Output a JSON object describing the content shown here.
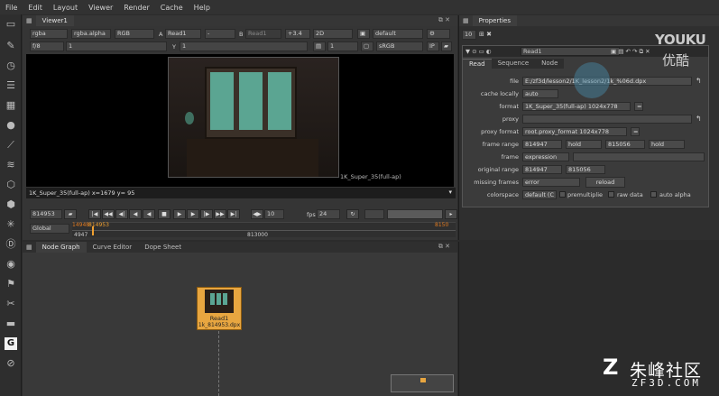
{
  "menu": [
    "File",
    "Edit",
    "Layout",
    "Viewer",
    "Render",
    "Cache",
    "Help"
  ],
  "viewer": {
    "tab": "Viewer1",
    "channels": "rgba",
    "alpha": "rgba.alpha",
    "color": "RGB",
    "a_label": "A",
    "a_input": "Read1",
    "b_label": "B",
    "b_input": "Read1",
    "gain": "+3.4",
    "mode": "2D",
    "lut": "default",
    "fstop": "f/8",
    "frame_in": "1",
    "y_label": "Y",
    "y_value": "1",
    "proxy_val": "1",
    "colorspace": "sRGB",
    "ip": "IP",
    "format_label": "1K_Super_35(full-ap)",
    "status": "1K_Super_35(full-ap)  x=1679 y= 95",
    "tc_current": "814953",
    "tc_step": "10",
    "fps_label": "fps",
    "fps": "24",
    "range_mode": "Global",
    "tick_start": "4947",
    "tick_mid": "813000",
    "tick_cur": "814953",
    "tick_left": "14948",
    "tick_end": "8150"
  },
  "nodegraph": {
    "tabs": [
      "Node Graph",
      "Curve Editor",
      "Dope Sheet"
    ],
    "node_name": "Read1",
    "node_file": "1k_814953.dpx"
  },
  "properties": {
    "tab": "Properties",
    "count": "10",
    "node_name": "Read1",
    "tabs": [
      "Read",
      "Sequence",
      "Node"
    ],
    "file_label": "file",
    "file": "E:/zf3d/lesson2/1K_lesson2/1k_%06d.dpx",
    "cache_label": "cache locally",
    "cache": "auto",
    "format_label": "format",
    "format": "1K_Super_35(full-ap) 1024x778",
    "proxy_label": "proxy",
    "proxy": "",
    "proxy_format_label": "proxy format",
    "proxy_format": "root.proxy_format 1024x778",
    "frame_range_label": "frame range",
    "frame_first": "814947",
    "first_mode": "hold",
    "frame_last": "815056",
    "last_mode": "hold",
    "frame_label": "frame",
    "frame_mode": "expression",
    "orig_range_label": "original range",
    "orig_first": "814947",
    "orig_last": "815056",
    "missing_label": "missing frames",
    "missing": "error",
    "reload": "reload",
    "colorspace_label": "colorspace",
    "colorspace": "default (C",
    "premultiplied": "premultiplie",
    "raw": "raw data",
    "auto_alpha": "auto alpha"
  },
  "watermark": {
    "youku_en": "YOUKU",
    "youku_cn": "优酷",
    "zf_cn": "朱峰社区",
    "zf_en": "ZF3D.COM"
  },
  "colors": {
    "node": "#e8a640",
    "viewer_frame": "#5ba592",
    "accent": "#f0a030"
  }
}
